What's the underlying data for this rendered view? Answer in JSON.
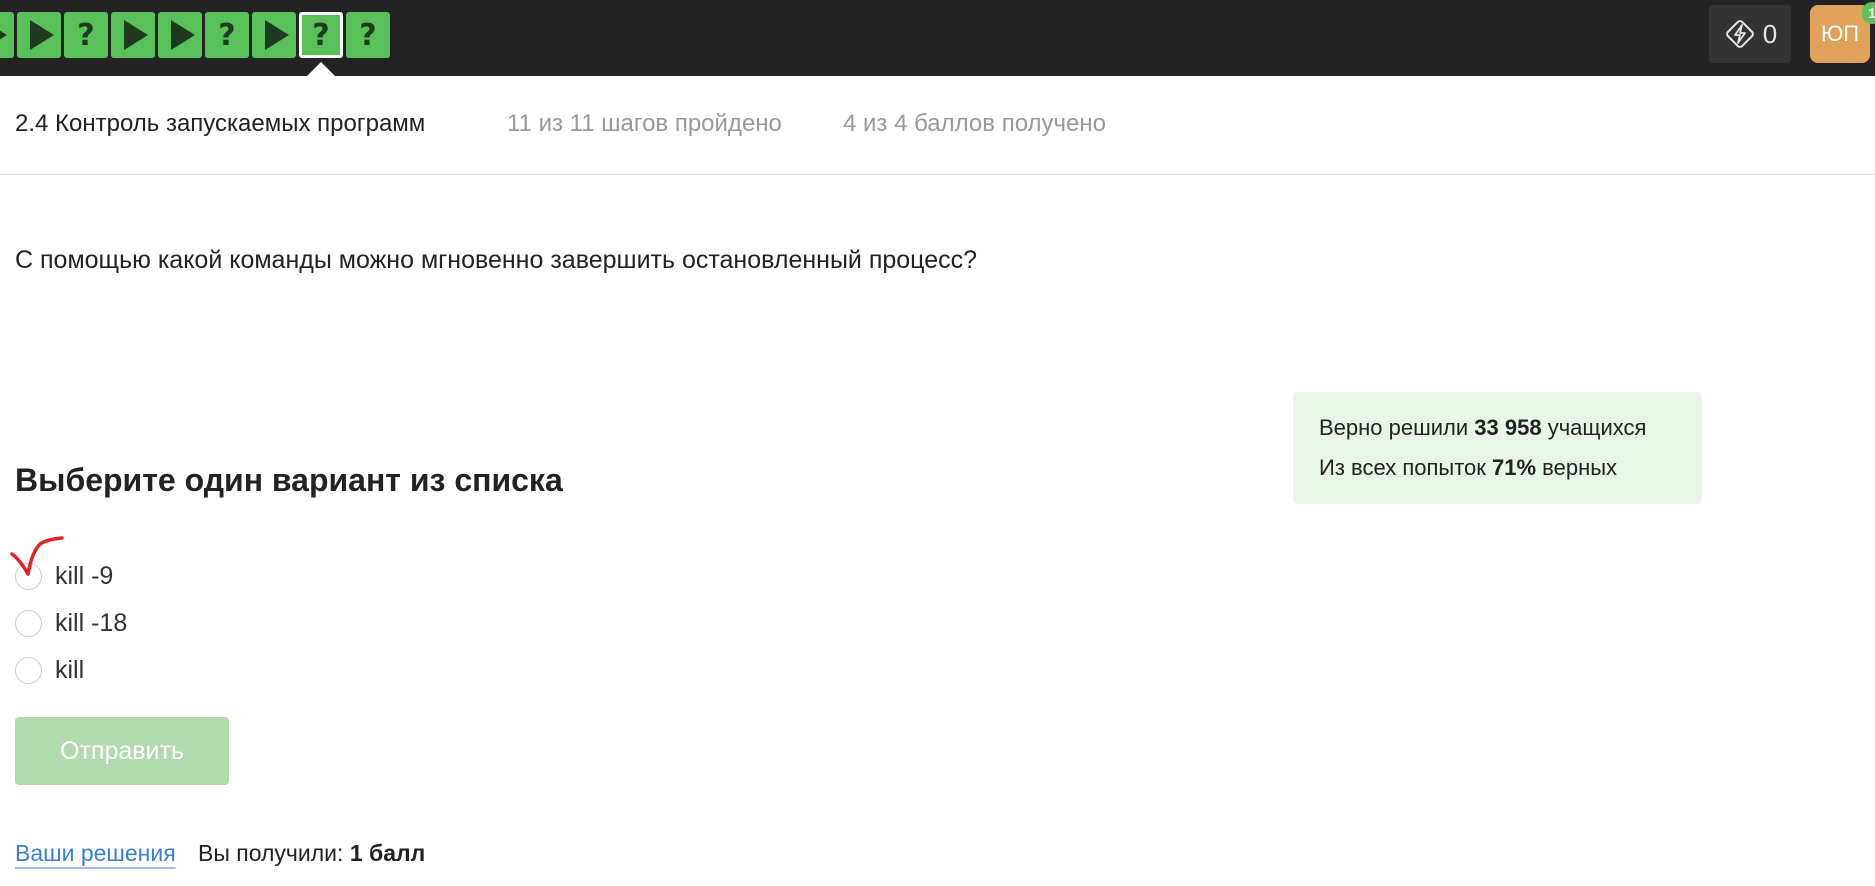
{
  "steps": [
    {
      "type": "play"
    },
    {
      "type": "question",
      "label": "?"
    },
    {
      "type": "play"
    },
    {
      "type": "play"
    },
    {
      "type": "question",
      "label": "?"
    },
    {
      "type": "play"
    },
    {
      "type": "question",
      "label": "?",
      "active": true
    },
    {
      "type": "question",
      "label": "?"
    }
  ],
  "header": {
    "energy_count": "0",
    "avatar_initials": "ЮП",
    "notification_count": "1"
  },
  "lesson": {
    "title": "2.4 Контроль запускаемых программ",
    "progress": "11 из 11 шагов пройдено",
    "score": "4 из 4 баллов  получено"
  },
  "question_text": "С помощью какой команды можно мгновенно завершить остановленный процесс?",
  "stats": {
    "solved_prefix": "Верно решили ",
    "solved_count": "33 958",
    "solved_suffix": " учащихся",
    "attempts_prefix": "Из всех попыток ",
    "attempts_percent": "71%",
    "attempts_suffix": " верных"
  },
  "choose_title": "Выберите один вариант из списка",
  "options": [
    {
      "label": "kill -9"
    },
    {
      "label": "kill -18"
    },
    {
      "label": "kill"
    }
  ],
  "submit_label": "Отправить",
  "footer": {
    "your_solutions": "Ваши решения",
    "result_prefix": "Вы получили: ",
    "result_value": "1 балл"
  },
  "colors": {
    "topbar": "#232323",
    "step_green": "#59c159",
    "stats_bg": "#e8f6e8",
    "submit_disabled": "#b1dbad",
    "link": "#3a7fd6",
    "check_mark": "#e0242b"
  }
}
